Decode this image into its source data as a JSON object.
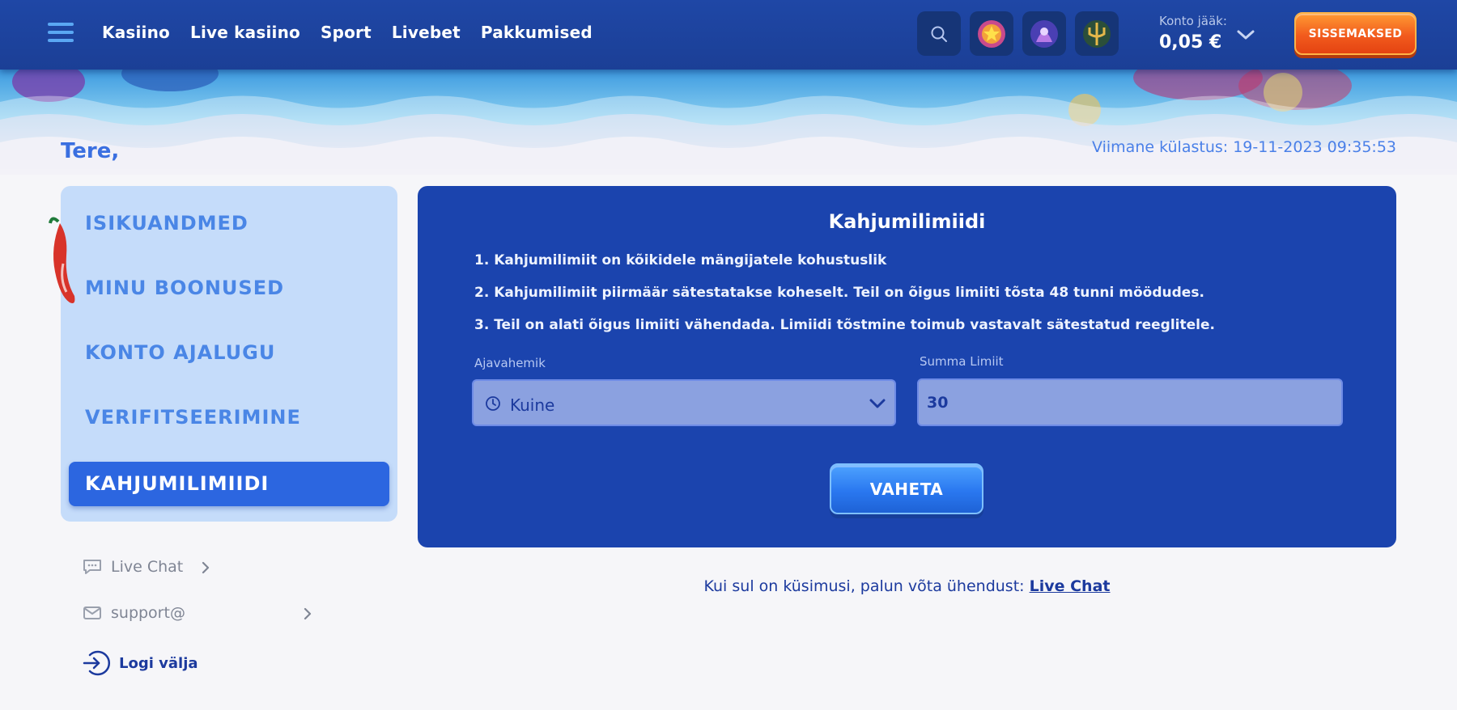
{
  "header": {
    "nav": [
      "Kasiino",
      "Live kasiino",
      "Sport",
      "Livebet",
      "Pakkumised"
    ],
    "balance_label": "Konto jääk:",
    "balance_value": "0,05 €",
    "deposit_label": "SISSEMAKSED"
  },
  "greeting": "Tere,",
  "last_login": "Viimane külastus: 19-11-2023 09:35:53",
  "sidebar": {
    "items": [
      "ISIKUANDMED",
      "MINU BOONUSED",
      "KONTO AJALUGU",
      "VERIFITSEERIMINE",
      "KAHJUMILIMIIDI"
    ],
    "active": "KAHJUMILIMIIDI"
  },
  "contact": {
    "chat_label": "Live Chat",
    "email_label": "support@",
    "logout_label": "Logi välja"
  },
  "panel": {
    "title": "Kahjumilimiidi",
    "rules": [
      "1. Kahjumilimiit on kõikidele mängijatele kohustuslik",
      "2. Kahjumilimiit piirmäär sätestatakse koheselt. Teil on õigus limiiti tõsta 48 tunni möödudes.",
      "3. Teil on alati õigus limiiti vähendada. Limiidi tõstmine toimub vastavalt sätestatud reeglitele."
    ],
    "period_label": "Ajavahemik",
    "period_value": "Kuine",
    "amount_label": "Summa Limiit",
    "amount_value": "30",
    "submit_label": "VAHETA"
  },
  "help": {
    "text": "Kui sul on küsimusi, palun võta ühendust: ",
    "link": "Live Chat"
  },
  "colors": {
    "header_bg": "#1f47a6",
    "panel_bg": "#1b44ae",
    "sidebar_bg": "#c5dcfa",
    "active_item": "#2c66e0",
    "deposit": "#f25b1d"
  },
  "icons": [
    "menu-icon",
    "search-icon",
    "game-thumb-icon",
    "chevron-down-icon",
    "chat-icon",
    "mail-icon",
    "logout-icon",
    "clock-icon"
  ]
}
